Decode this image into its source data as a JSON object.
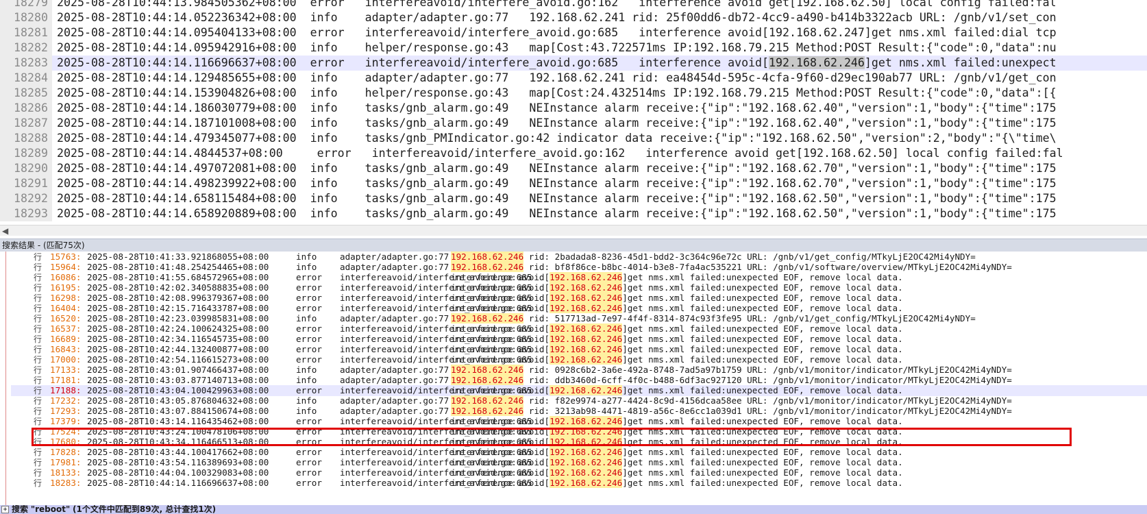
{
  "editor": {
    "lines": [
      {
        "num": "18279",
        "ts": "2025-08-28T10:44:13.984505362+08:00",
        "lvl": "error",
        "src": "interfereavoid/interfere_avoid.go:162",
        "msg": "interference avoid get[192.168.62.50] local config failed:fal"
      },
      {
        "num": "18280",
        "ts": "2025-08-28T10:44:14.052236342+08:00",
        "lvl": "info",
        "src": "adapter/adapter.go:77",
        "msg": "192.168.62.241 rid: 25f00dd6-db72-4cc9-a490-b414b3322acb URL: /gnb/v1/set_con"
      },
      {
        "num": "18281",
        "ts": "2025-08-28T10:44:14.095404133+08:00",
        "lvl": "error",
        "src": "interfereavoid/interfere_avoid.go:685",
        "msg": "interference avoid[192.168.62.247]get nms.xml failed:dial tcp"
      },
      {
        "num": "18282",
        "ts": "2025-08-28T10:44:14.095942916+08:00",
        "lvl": "info",
        "src": "helper/response.go:43",
        "msg": "map[Cost:43.722571ms IP:192.168.79.215 Method:POST Result:{\"code\":0,\"data\":nu"
      },
      {
        "num": "18283",
        "ts": "2025-08-28T10:44:14.116696637+08:00",
        "lvl": "error",
        "src": "interfereavoid/interfere_avoid.go:685",
        "msg_pre": "interference avoid[",
        "msg_mark": "192.168.62.246",
        "msg_post": "]get nms.xml failed:unexpect"
      },
      {
        "num": "18284",
        "ts": "2025-08-28T10:44:14.129485655+08:00",
        "lvl": "info",
        "src": "adapter/adapter.go:77",
        "msg": "192.168.62.241 rid: ea48454d-595c-4cfa-9f60-d29ec190ab77 URL: /gnb/v1/get_con"
      },
      {
        "num": "18285",
        "ts": "2025-08-28T10:44:14.153904826+08:00",
        "lvl": "info",
        "src": "helper/response.go:43",
        "msg": "map[Cost:24.432514ms IP:192.168.79.215 Method:POST Result:{\"code\":0,\"data\":[{"
      },
      {
        "num": "18286",
        "ts": "2025-08-28T10:44:14.186030779+08:00",
        "lvl": "info",
        "src": "tasks/gnb_alarm.go:49",
        "msg": "NEInstance alarm receive:{\"ip\":\"192.168.62.40\",\"version\":1,\"body\":{\"time\":175"
      },
      {
        "num": "18287",
        "ts": "2025-08-28T10:44:14.187101008+08:00",
        "lvl": "info",
        "src": "tasks/gnb_alarm.go:49",
        "msg": "NEInstance alarm receive:{\"ip\":\"192.168.62.40\",\"version\":1,\"body\":{\"time\":175"
      },
      {
        "num": "18288",
        "ts": "2025-08-28T10:44:14.479345077+08:00",
        "lvl": "info",
        "src": "tasks/gnb_PMIndicator.go:42",
        "msg": "indicator data receive:{\"ip\":\"192.168.62.50\",\"version\":2,\"body\":\"{\\\"time\\"
      },
      {
        "num": "18289",
        "ts": "2025-08-28T10:44:14.4844537+08:00",
        "lvl": "error",
        "src": "interfereavoid/interfere_avoid.go:162",
        "msg": "interference avoid get[192.168.62.50] local config failed:fal"
      },
      {
        "num": "18290",
        "ts": "2025-08-28T10:44:14.497072081+08:00",
        "lvl": "info",
        "src": "tasks/gnb_alarm.go:49",
        "msg": "NEInstance alarm receive:{\"ip\":\"192.168.62.70\",\"version\":1,\"body\":{\"time\":175"
      },
      {
        "num": "18291",
        "ts": "2025-08-28T10:44:14.498239922+08:00",
        "lvl": "info",
        "src": "tasks/gnb_alarm.go:49",
        "msg": "NEInstance alarm receive:{\"ip\":\"192.168.62.70\",\"version\":1,\"body\":{\"time\":175"
      },
      {
        "num": "18292",
        "ts": "2025-08-28T10:44:14.658115484+08:00",
        "lvl": "info",
        "src": "tasks/gnb_alarm.go:49",
        "msg": "NEInstance alarm receive:{\"ip\":\"192.168.62.50\",\"version\":1,\"body\":{\"time\":175"
      },
      {
        "num": "18293",
        "ts": "2025-08-28T10:44:14.658920889+08:00",
        "lvl": "info",
        "src": "tasks/gnb_alarm.go:49",
        "msg": "NEInstance alarm receive:{\"ip\":\"192.168.62.50\",\"version\":1,\"body\":{\"time\":175"
      }
    ]
  },
  "results": {
    "header": "搜索结果 - (匹配75次)",
    "prefix": "行",
    "lines": [
      {
        "num": "15763:",
        "ts": "2025-08-28T10:41:33.921868055+08:00",
        "lvl": "info",
        "src": "adapter/adapter.go:77",
        "pre": "",
        "ip": "192.168.62.246",
        "post": " rid: 2badada8-8236-45d1-bdd2-3c364c96e72c URL: /gnb/v1/get_config/MTkyLjE2OC42Mi4yNDY="
      },
      {
        "num": "15964:",
        "ts": "2025-08-28T10:41:48.254254465+08:00",
        "lvl": "info",
        "src": "adapter/adapter.go:77",
        "pre": "",
        "ip": "192.168.62.246",
        "post": " rid: bf8f86ce-b8bc-4014-b3e8-7fa4ac535221 URL: /gnb/v1/software/overview/MTkyLjE2OC42Mi4yNDY="
      },
      {
        "num": "16086:",
        "ts": "2025-08-28T10:41:55.684572965+08:00",
        "lvl": "error",
        "src": "interfereavoid/interfere_avoid.go:685",
        "pre": "interference avoid[",
        "ip": "192.168.62.246",
        "post": "]get nms.xml failed:unexpected EOF, remove local data."
      },
      {
        "num": "16195:",
        "ts": "2025-08-28T10:42:02.340588835+08:00",
        "lvl": "error",
        "src": "interfereavoid/interfere_avoid.go:685",
        "pre": "interference avoid[",
        "ip": "192.168.62.246",
        "post": "]get nms.xml failed:unexpected EOF, remove local data."
      },
      {
        "num": "16298:",
        "ts": "2025-08-28T10:42:08.996379367+08:00",
        "lvl": "error",
        "src": "interfereavoid/interfere_avoid.go:685",
        "pre": "interference avoid[",
        "ip": "192.168.62.246",
        "post": "]get nms.xml failed:unexpected EOF, remove local data."
      },
      {
        "num": "16404:",
        "ts": "2025-08-28T10:42:15.716433787+08:00",
        "lvl": "error",
        "src": "interfereavoid/interfere_avoid.go:685",
        "pre": "interference avoid[",
        "ip": "192.168.62.246",
        "post": "]get nms.xml failed:unexpected EOF, remove local data."
      },
      {
        "num": "16520:",
        "ts": "2025-08-28T10:42:23.039985831+08:00",
        "lvl": "info",
        "src": "adapter/adapter.go:77",
        "pre": "",
        "ip": "192.168.62.246",
        "post": " rid: 517713ad-7e97-4f4f-8314-874c93f3fe95 URL: /gnb/v1/get_config/MTkyLjE2OC42Mi4yNDY="
      },
      {
        "num": "16537:",
        "ts": "2025-08-28T10:42:24.100624325+08:00",
        "lvl": "error",
        "src": "interfereavoid/interfere_avoid.go:685",
        "pre": "interference avoid[",
        "ip": "192.168.62.246",
        "post": "]get nms.xml failed:unexpected EOF, remove local data."
      },
      {
        "num": "16689:",
        "ts": "2025-08-28T10:42:34.116545735+08:00",
        "lvl": "error",
        "src": "interfereavoid/interfere_avoid.go:685",
        "pre": "interference avoid[",
        "ip": "192.168.62.246",
        "post": "]get nms.xml failed:unexpected EOF, remove local data."
      },
      {
        "num": "16843:",
        "ts": "2025-08-28T10:42:44.132400877+08:00",
        "lvl": "error",
        "src": "interfereavoid/interfere_avoid.go:685",
        "pre": "interference avoid[",
        "ip": "192.168.62.246",
        "post": "]get nms.xml failed:unexpected EOF, remove local data."
      },
      {
        "num": "17000:",
        "ts": "2025-08-28T10:42:54.116615273+08:00",
        "lvl": "error",
        "src": "interfereavoid/interfere_avoid.go:685",
        "pre": "interference avoid[",
        "ip": "192.168.62.246",
        "post": "]get nms.xml failed:unexpected EOF, remove local data."
      },
      {
        "num": "17133:",
        "ts": "2025-08-28T10:43:01.907466437+08:00",
        "lvl": "info",
        "src": "adapter/adapter.go:77",
        "pre": "",
        "ip": "192.168.62.246",
        "post": " rid: 0928c6b2-3a6e-492a-8748-7ad5a97b1759 URL: /gnb/v1/monitor/indicator/MTkyLjE2OC42Mi4yNDY="
      },
      {
        "num": "17181:",
        "ts": "2025-08-28T10:43:03.877140713+08:00",
        "lvl": "info",
        "src": "adapter/adapter.go:77",
        "pre": "",
        "ip": "192.168.62.246",
        "post": " rid: ddb3460d-6cff-4f0c-b488-6df3ac927120 URL: /gnb/v1/monitor/indicator/MTkyLjE2OC42Mi4yNDY="
      },
      {
        "num": "17188:",
        "ts": "2025-08-28T10:43:04.100429963+08:00",
        "lvl": "error",
        "src": "interfereavoid/interfere_avoid.go:685",
        "pre": "interference avoid[",
        "ip": "192.168.62.246",
        "post": "]get nms.xml failed:unexpected EOF, remove local data."
      },
      {
        "num": "17232:",
        "ts": "2025-08-28T10:43:05.876804632+08:00",
        "lvl": "info",
        "src": "adapter/adapter.go:77",
        "pre": "",
        "ip": "192.168.62.246",
        "post": " rid: f82e9974-a277-4424-8c9d-4156dcaa58ee URL: /gnb/v1/monitor/indicator/MTkyLjE2OC42Mi4yNDY="
      },
      {
        "num": "17293:",
        "ts": "2025-08-28T10:43:07.884150674+08:00",
        "lvl": "info",
        "src": "adapter/adapter.go:77",
        "pre": "",
        "ip": "192.168.62.246",
        "post": " rid: 3213ab98-4471-4819-a56c-8e6cc1a039d1 URL: /gnb/v1/monitor/indicator/MTkyLjE2OC42Mi4yNDY="
      },
      {
        "num": "17379:",
        "ts": "2025-08-28T10:43:14.116435462+08:00",
        "lvl": "error",
        "src": "interfereavoid/interfere_avoid.go:685",
        "pre": "interference avoid[",
        "ip": "192.168.62.246",
        "post": "]get nms.xml failed:unexpected EOF, remove local data."
      },
      {
        "num": "17524:",
        "ts": "2025-08-28T10:43:24.100478106+08:00",
        "lvl": "error",
        "src": "interfereavoid/interfere_avoid.go:685",
        "pre": "interference avoid[",
        "ip": "192.168.62.246",
        "post": "]get nms.xml failed:unexpected EOF, remove local data."
      },
      {
        "num": "17680:",
        "ts": "2025-08-28T10:43:34.116466513+08:00",
        "lvl": "error",
        "src": "interfereavoid/interfere_avoid.go:685",
        "pre": "interference avoid[",
        "ip": "192.168.62.246",
        "post": "]get nms.xml failed:unexpected EOF, remove local data."
      },
      {
        "num": "17828:",
        "ts": "2025-08-28T10:43:44.100417662+08:00",
        "lvl": "error",
        "src": "interfereavoid/interfere_avoid.go:685",
        "pre": "interference avoid[",
        "ip": "192.168.62.246",
        "post": "]get nms.xml failed:unexpected EOF, remove local data."
      },
      {
        "num": "17981:",
        "ts": "2025-08-28T10:43:54.116389693+08:00",
        "lvl": "error",
        "src": "interfereavoid/interfere_avoid.go:685",
        "pre": "interference avoid[",
        "ip": "192.168.62.246",
        "post": "]get nms.xml failed:unexpected EOF, remove local data."
      },
      {
        "num": "18133:",
        "ts": "2025-08-28T10:44:04.100329083+08:00",
        "lvl": "error",
        "src": "interfereavoid/interfere_avoid.go:685",
        "pre": "interference avoid[",
        "ip": "192.168.62.246",
        "post": "]get nms.xml failed:unexpected EOF, remove local data."
      },
      {
        "num": "18283:",
        "ts": "2025-08-28T10:44:14.116696637+08:00",
        "lvl": "error",
        "src": "interfereavoid/interfere_avoid.go:685",
        "pre": "interference avoid[",
        "ip": "192.168.62.246",
        "post": "]get nms.xml failed:unexpected EOF, remove local data."
      }
    ]
  },
  "bottom_bar": {
    "label": "搜索",
    "query": "\"reboot\"",
    "summary": "(1个文件中匹配到89次, 总计查找1次)"
  }
}
